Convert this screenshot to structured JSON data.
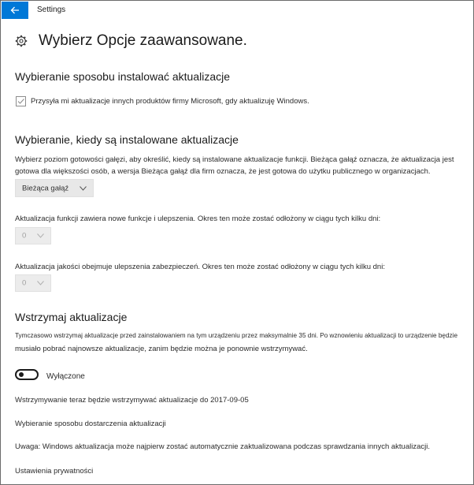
{
  "window": {
    "title": "Settings"
  },
  "page": {
    "title": "Wybierz Opcje zaawansowane."
  },
  "install": {
    "heading": "Wybieranie sposobu instalować aktualizacje",
    "checkbox_label": "Przysyła mi aktualizacje innych produktów firmy Microsoft, gdy aktualizuję Windows.",
    "checkbox_checked": true
  },
  "branch": {
    "heading": "Wybieranie, kiedy są instalowane aktualizacje",
    "description_line1": "Wybierz poziom gotowości gałęzi, aby określić, kiedy są instalowane aktualizacje funkcji. Bieżąca gałąź oznacza, że aktualizacja jest",
    "description_line2": "gotowa dla większości osób, a wersja Bieżąca gałąź dla firm oznacza, że jest gotowa do użytku publicznego w organizacjach.",
    "dropdown_value": "Bieżąca gałąź"
  },
  "feature_deferral": {
    "label": "Aktualizacja funkcji zawiera nowe funkcje i ulepszenia. Okres ten może zostać odłożony w ciągu tych kilku dni:",
    "value": "0"
  },
  "quality_deferral": {
    "label": "Aktualizacja jakości obejmuje ulepszenia zabezpieczeń. Okres ten może zostać odłożony w ciągu tych kilku dni:",
    "value": "0"
  },
  "pause": {
    "heading": "Wstrzymaj aktualizacje",
    "description_line1": "Tymczasowo wstrzymaj aktualizacje przed zainstalowaniem na tym urządzeniu przez maksymalnie 35 dni. Po wznowieniu aktualizacji to urządzenie będzie",
    "description_line2": "musiało pobrać najnowsze aktualizacje, zanim będzie można je ponownie wstrzymywać.",
    "toggle_label": "Wyłączone",
    "toggle_on": false,
    "until_text": "Wstrzymywanie teraz będzie wstrzymywać aktualizacje do 2017-09-05"
  },
  "links": {
    "delivery": "Wybieranie sposobu dostarczenia aktualizacji",
    "note": "Uwaga: Windows aktualizacja może najpierw zostać automatycznie zaktualizowana podczas sprawdzania innych aktualizacji.",
    "privacy": "Ustawienia prywatności"
  },
  "colors": {
    "accent": "#0078d7",
    "text": "#1b1b1b"
  },
  "icons": {
    "back": "back-arrow-icon",
    "settings": "gear-icon",
    "check": "checkmark-icon",
    "dropdown": "chevron-down-icon"
  }
}
